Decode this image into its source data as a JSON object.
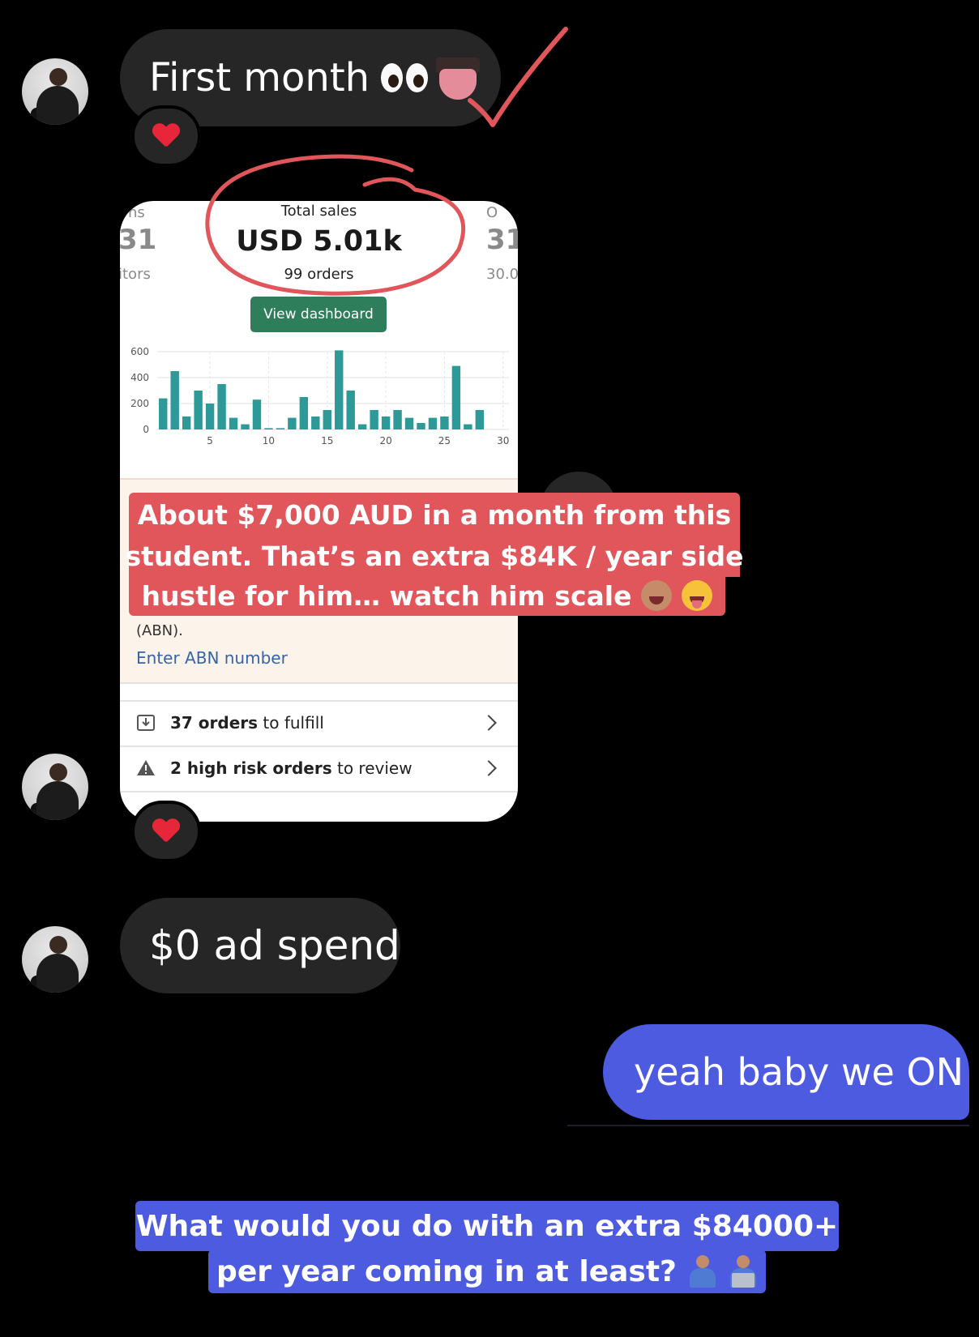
{
  "messages": {
    "first_month": "First month",
    "ad_spend": "$0 ad spend",
    "sent_reply": "yeah baby we ON"
  },
  "reactions": {
    "emoji": "heart"
  },
  "shopify": {
    "left_stat_top": "ns",
    "left_stat_value": "31",
    "left_stat_sub": "itors",
    "total_label": "Total sales",
    "total_value": "USD 5.01k",
    "total_orders": "99 orders",
    "right_stat_top": "O",
    "right_stat_value": "31",
    "right_stat_sub": "30.0",
    "button_label": "View dashboard",
    "abn_text": "(ABN).",
    "abn_link": "Enter ABN number",
    "tasks": [
      {
        "bold": "37 orders",
        "rest": " to fulfill",
        "icon": "download-box-icon"
      },
      {
        "bold": "2 high risk orders",
        "rest": " to review",
        "icon": "warning-icon"
      }
    ]
  },
  "chart_data": {
    "type": "bar",
    "x": [
      1,
      2,
      3,
      4,
      5,
      6,
      7,
      8,
      9,
      10,
      11,
      12,
      13,
      14,
      15,
      16,
      17,
      18,
      19,
      20,
      21,
      22,
      23,
      24,
      25,
      26,
      27,
      28,
      29
    ],
    "values": [
      240,
      450,
      100,
      300,
      200,
      350,
      90,
      40,
      230,
      10,
      10,
      90,
      250,
      100,
      150,
      610,
      300,
      40,
      150,
      100,
      150,
      90,
      50,
      90,
      100,
      490,
      40,
      150,
      0
    ],
    "ylim": [
      0,
      600
    ],
    "yticks": [
      0,
      200,
      400,
      600
    ],
    "xticks": [
      5,
      10,
      15,
      20,
      25,
      30
    ],
    "grid": true,
    "color": "#2e9a98"
  },
  "banner": {
    "line1": "About $7,000 AUD in a month from this",
    "line2": "student. That’s an extra $84K / year side",
    "line3": "hustle for him… watch him scale"
  },
  "caption": {
    "line1": "What would you do with an extra $84000+",
    "line2": "per year coming in at least?"
  },
  "colors": {
    "bubble_received": "#262626",
    "bubble_sent": "#4d5be0",
    "annotation_red": "#e0565a",
    "shopify_green": "#2e7d5b"
  }
}
